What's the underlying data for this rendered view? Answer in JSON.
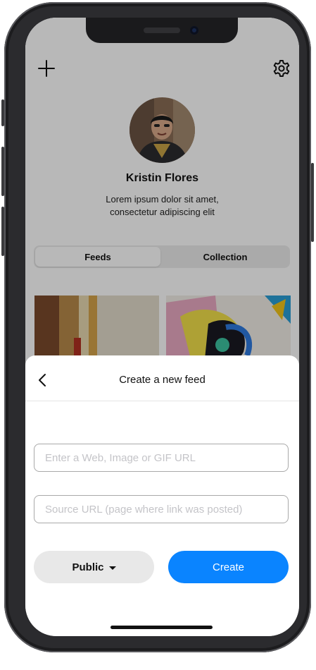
{
  "profile": {
    "name": "Kristin Flores",
    "bio": "Lorem ipsum dolor sit amet, consectetur adipiscing elit",
    "tabs": [
      {
        "label": "Feeds",
        "active": true
      },
      {
        "label": "Collection",
        "active": false
      }
    ],
    "add_icon": "plus-icon",
    "settings_icon": "gear-icon"
  },
  "sheet": {
    "title": "Create a new feed",
    "back_icon": "chevron-left-icon",
    "url_field": {
      "value": "",
      "placeholder": "Enter a Web, Image or GIF URL"
    },
    "source_field": {
      "value": "",
      "placeholder": "Source URL (page where link was posted)"
    },
    "visibility_label": "Public",
    "create_label": "Create"
  },
  "colors": {
    "accent": "#0a84ff",
    "secondary_button": "#e8e8e8",
    "frame": "#2b2b2e"
  }
}
